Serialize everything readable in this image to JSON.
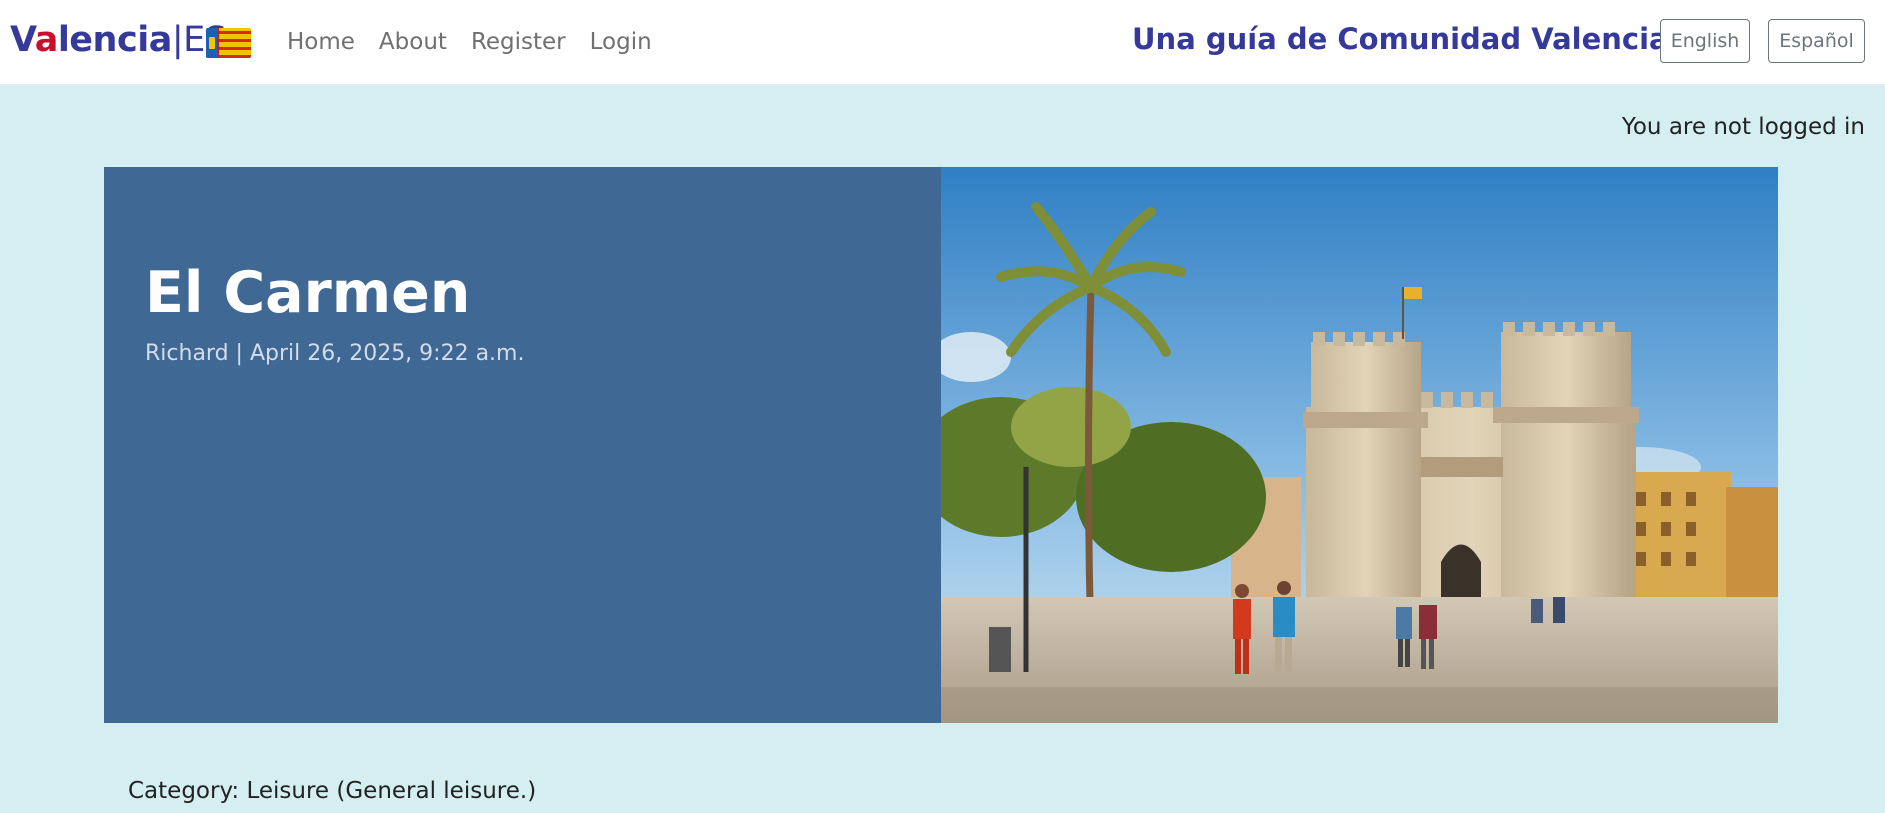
{
  "brand": {
    "part_v": "V",
    "part_a": "a",
    "part_lencia": "lencia",
    "part_es": "|ES",
    "flag_icon": "valencian-flag-icon"
  },
  "nav": {
    "home": "Home",
    "about": "About",
    "register": "Register",
    "login": "Login"
  },
  "header": {
    "tagline": "Una guía de Comunidad Valenciana  |",
    "english": "English",
    "espanol": "Español"
  },
  "status": {
    "login_status": "You are not logged in"
  },
  "post": {
    "title": "El Carmen",
    "meta": "Richard | April 26, 2025, 9:22 a.m.",
    "category": "Category: Leisure (General leisure.)"
  },
  "colors": {
    "brand_blue": "#34399a",
    "brand_red": "#c8102e",
    "page_bg": "#d5eef1",
    "hero_panel": "#3f6895"
  }
}
